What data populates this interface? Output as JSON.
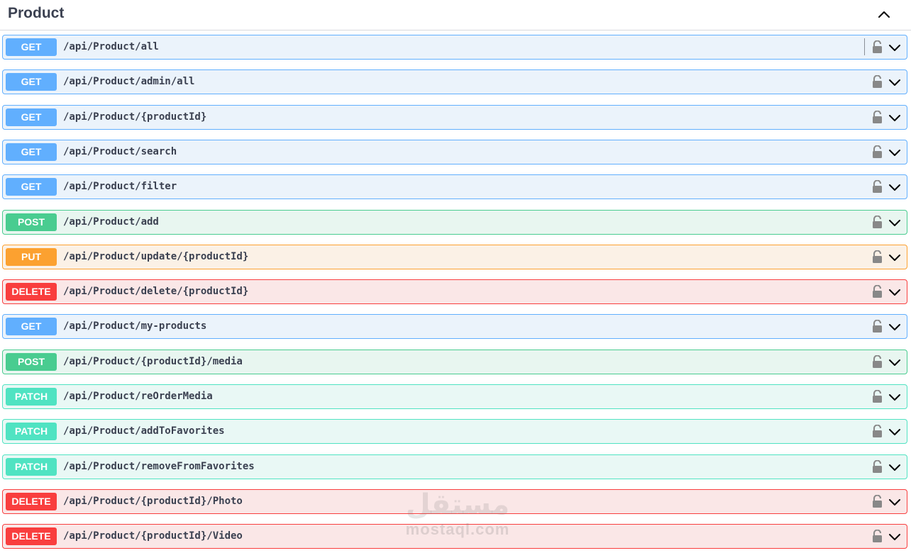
{
  "section": {
    "title": "Product",
    "collapse_icon": "chevron-up-icon"
  },
  "operations": [
    {
      "method": "GET",
      "path": "/api/Product/all",
      "color": "#61affe"
    },
    {
      "method": "GET",
      "path": "/api/Product/admin/all",
      "color": "#61affe"
    },
    {
      "method": "GET",
      "path": "/api/Product/{productId}",
      "color": "#61affe"
    },
    {
      "method": "GET",
      "path": "/api/Product/search",
      "color": "#61affe"
    },
    {
      "method": "GET",
      "path": "/api/Product/filter",
      "color": "#61affe"
    },
    {
      "method": "POST",
      "path": "/api/Product/add",
      "color": "#49cc90"
    },
    {
      "method": "PUT",
      "path": "/api/Product/update/{productId}",
      "color": "#fca130"
    },
    {
      "method": "DELETE",
      "path": "/api/Product/delete/{productId}",
      "color": "#f93e3e"
    },
    {
      "method": "GET",
      "path": "/api/Product/my-products",
      "color": "#61affe"
    },
    {
      "method": "POST",
      "path": "/api/Product/{productId}/media",
      "color": "#49cc90"
    },
    {
      "method": "PATCH",
      "path": "/api/Product/reOrderMedia",
      "color": "#50e3c2"
    },
    {
      "method": "PATCH",
      "path": "/api/Product/addToFavorites",
      "color": "#50e3c2"
    },
    {
      "method": "PATCH",
      "path": "/api/Product/removeFromFavorites",
      "color": "#50e3c2"
    },
    {
      "method": "DELETE",
      "path": "/api/Product/{productId}/Photo",
      "color": "#f93e3e"
    },
    {
      "method": "DELETE",
      "path": "/api/Product/{productId}/Video",
      "color": "#f93e3e"
    }
  ],
  "row_icons": {
    "lock": "unlocked-padlock-icon",
    "expand": "chevron-down-icon"
  },
  "watermark": {
    "glyph": "مستقل",
    "text": "mostaql.com"
  }
}
